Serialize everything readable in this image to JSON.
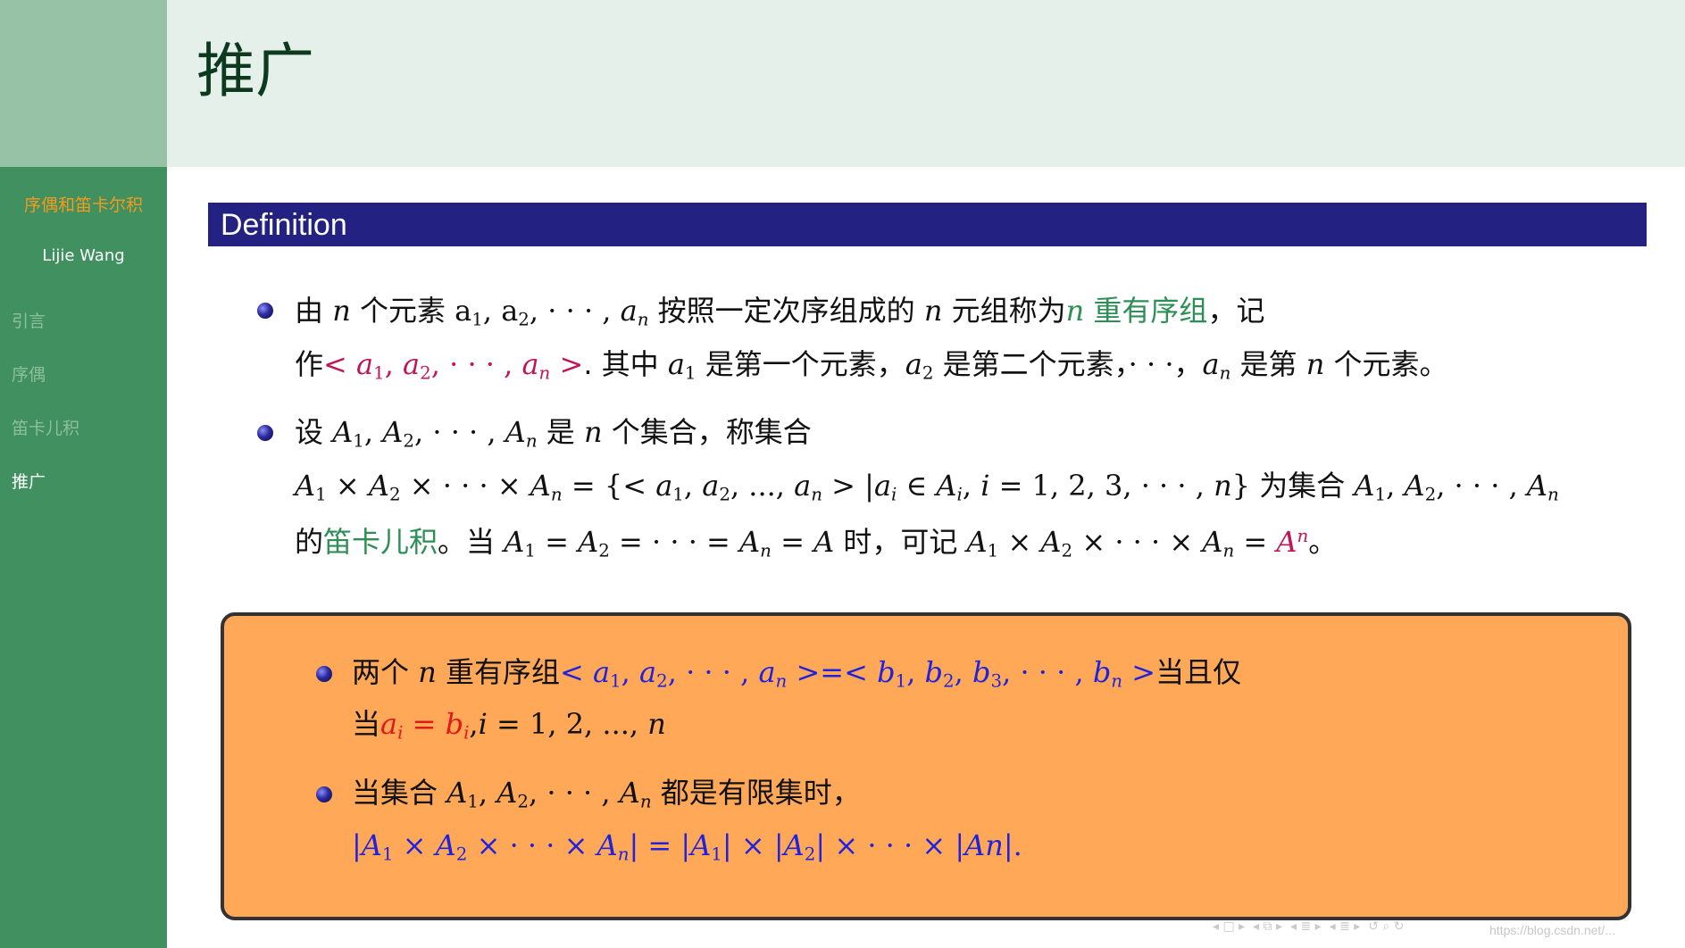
{
  "header": {
    "title": "推广"
  },
  "sidebar": {
    "title": "序偶和笛卡尔积",
    "author": "Lijie Wang",
    "nav": [
      "引言",
      "序偶",
      "笛卡儿积",
      "推广"
    ],
    "active_index": 3
  },
  "definition": {
    "label": "Definition",
    "b1": {
      "l1_a": "由 ",
      "l1_b": " 个元素 ",
      "l1_c": " 按照一定次序组成的 ",
      "l1_d": " 元组称为",
      "l1_highlight": "重有序组",
      "l1_e": "，记",
      "l2_a": "作",
      "l2_b": ". 其中 ",
      "l2_c": " 是第一个元素，",
      "l2_d": " 是第二个元素，",
      "l2_e": "，",
      "l2_f": " 是第 ",
      "l2_g": " 个元素。"
    },
    "b2": {
      "l1_a": "设 ",
      "l1_b": " 是 ",
      "l1_c": " 个集合，称集合",
      "l2_a": " 为集合 ",
      "l3_a": "的",
      "l3_highlight": "笛卡儿积",
      "l3_b": "。当 ",
      "l3_c": " 时，可记 ",
      "l3_d": "。"
    }
  },
  "block": {
    "b1": {
      "l1_a": "两个 ",
      "l1_b": " 重有序组",
      "l1_c": "当且仅",
      "l2_a": "当"
    },
    "b2": {
      "l1_a": "当集合 ",
      "l1_b": " 都是有限集时，"
    }
  },
  "footer": {
    "watermark": "https://blog.csdn.net/..."
  },
  "colors": {
    "sidebar": "#41905f",
    "header": "#e6f0ea",
    "definition_bar": "#232182",
    "block_bg": "#ffa858",
    "accent_orange": "#f59a1f",
    "highlight_green": "#2e8f56",
    "tuple_pink": "#c01657",
    "math_blue": "#2222dd",
    "math_red": "#e01a1a"
  }
}
